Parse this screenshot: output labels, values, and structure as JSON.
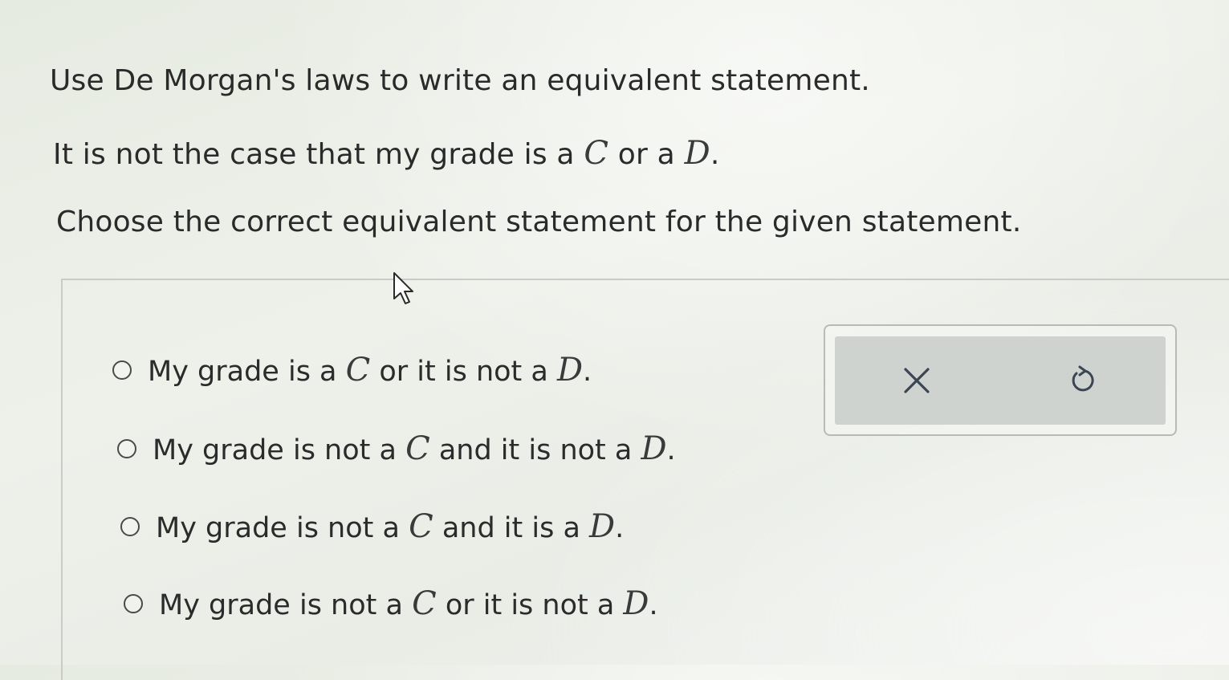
{
  "question": {
    "instruction": "Use De Morgan's laws to write an equivalent statement.",
    "statement": {
      "prefix": "It is not the case that my grade is a ",
      "var1": "C",
      "middle": " or a ",
      "var2": "D",
      "suffix": "."
    },
    "prompt": "Choose the correct equivalent statement for the given statement."
  },
  "options": [
    {
      "prefix": "My grade is a ",
      "var1": "C",
      "middle": " or it is not a ",
      "var2": "D",
      "suffix": "."
    },
    {
      "prefix": "My grade is not a ",
      "var1": "C",
      "middle": " and it is not a ",
      "var2": "D",
      "suffix": "."
    },
    {
      "prefix": "My grade is not a ",
      "var1": "C",
      "middle": " and it is a ",
      "var2": "D",
      "suffix": "."
    },
    {
      "prefix": "My grade is not a ",
      "var1": "C",
      "middle": " or it is not a ",
      "var2": "D",
      "suffix": "."
    }
  ],
  "tools": {
    "clear_icon": "close-icon",
    "undo_icon": "undo-icon"
  }
}
